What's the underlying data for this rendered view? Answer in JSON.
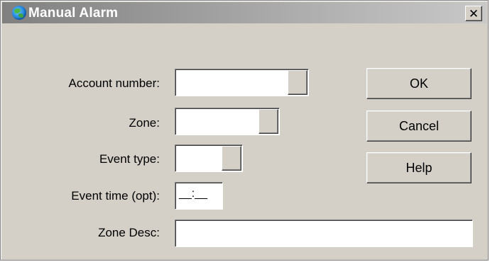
{
  "window": {
    "title": "Manual Alarm",
    "close_glyph": "✕",
    "icon": "globe-icon"
  },
  "form": {
    "account_number_label": "Account number:",
    "account_number_value": "",
    "zone_label": "Zone:",
    "zone_value": "",
    "event_type_label": "Event type:",
    "event_type_value": "",
    "event_time_label": "Event time (opt):",
    "event_time_value": "__:__",
    "zone_desc_label": "Zone Desc:",
    "zone_desc_value": ""
  },
  "buttons": {
    "ok": "OK",
    "cancel": "Cancel",
    "help": "Help"
  },
  "colors": {
    "dialog_bg": "#d4d0c8",
    "title_gradient_start": "#808080",
    "title_gradient_end": "#c8c8c8",
    "title_text": "#ffffff"
  }
}
